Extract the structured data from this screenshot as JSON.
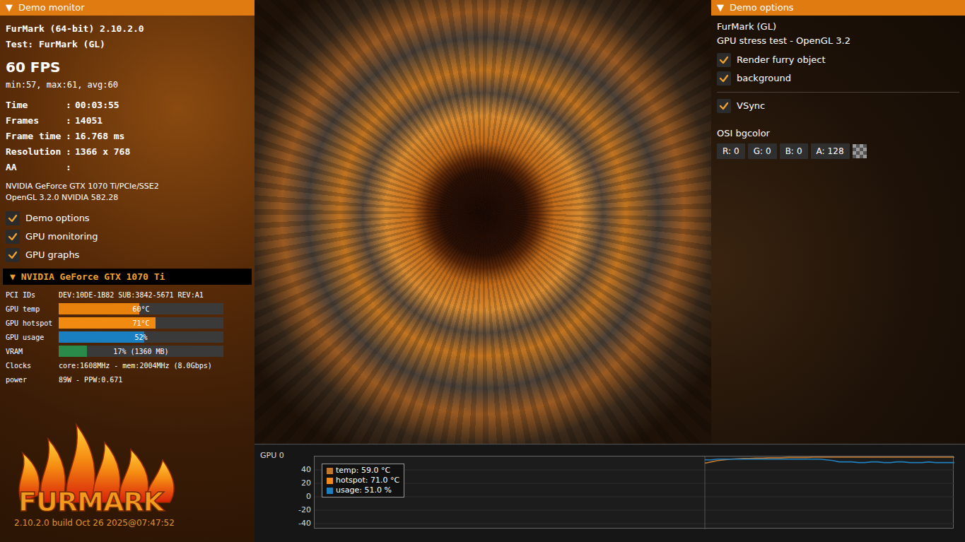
{
  "monitor": {
    "toggle": "▼",
    "title": "Demo monitor",
    "app": "FurMark (64-bit) 2.10.2.0",
    "test": "Test: FurMark (GL)",
    "fps": "60 FPS",
    "fps_stats": "min:57, max:61, avg:60",
    "stats": [
      {
        "label": "Time",
        "sep": ":",
        "value": "00:03:55"
      },
      {
        "label": "Frames",
        "sep": ":",
        "value": "14051"
      },
      {
        "label": "Frame time",
        "sep": ":",
        "value": "16.768 ms"
      },
      {
        "label": "Resolution",
        "sep": ":",
        "value": "1366 x 768"
      },
      {
        "label": "AA",
        "sep": ":",
        "value": ""
      }
    ],
    "renderer": "NVIDIA GeForce GTX 1070 Ti/PCIe/SSE2",
    "gl": "OpenGL 3.2.0 NVIDIA 582.28",
    "toggles": [
      {
        "label": "Demo options",
        "checked": true
      },
      {
        "label": "GPU monitoring",
        "checked": true
      },
      {
        "label": "GPU graphs",
        "checked": true
      }
    ]
  },
  "gpu": {
    "toggle": "▼",
    "title": "NVIDIA GeForce GTX 1070 Ti",
    "rows": [
      {
        "kind": "text",
        "label": "PCI IDs",
        "value": "DEV:10DE-1B82 SUB:3842-5671 REV:A1"
      },
      {
        "kind": "bar",
        "label": "GPU temp",
        "value": "60°C",
        "level": 0.49,
        "color": "#e8820c"
      },
      {
        "kind": "bar",
        "label": "GPU hotspot",
        "value": "71°C",
        "level": 0.59,
        "color": "#f08a10"
      },
      {
        "kind": "bar",
        "label": "GPU usage",
        "value": "52%",
        "level": 0.52,
        "color": "#1a7fc0"
      },
      {
        "kind": "bar",
        "label": "VRAM",
        "value": "17% (1360 MB)",
        "level": 0.17,
        "color": "#2a8a4a"
      },
      {
        "kind": "text",
        "label": "Clocks",
        "value": "core:1608MHz - mem:2004MHz (8.0Gbps)"
      },
      {
        "kind": "text",
        "label": "power",
        "value": "89W - PPW:0.671"
      }
    ]
  },
  "logo": {
    "text": "FURMARK",
    "build": "2.10.2.0 build Oct 26 2025@07:47:52"
  },
  "options": {
    "toggle": "▼",
    "title": "Demo options",
    "name": "FurMark (GL)",
    "subtitle": "GPU stress test - OpenGL 3.2",
    "toggles": [
      {
        "label": "Render furry object",
        "checked": true
      },
      {
        "label": "background",
        "checked": true
      }
    ],
    "vsync": {
      "label": "VSync",
      "checked": true
    },
    "bgcolor": {
      "label": "OSI bgcolor",
      "fields": [
        {
          "label": "R:",
          "value": "0"
        },
        {
          "label": "G:",
          "value": "0"
        },
        {
          "label": "B:",
          "value": "0"
        },
        {
          "label": "A:",
          "value": "128"
        }
      ]
    }
  },
  "chart": {
    "title": "GPU 0",
    "y_ticks": [
      "40",
      "20",
      "0",
      "-20",
      "-40"
    ],
    "legend": [
      {
        "label": "temp: 59.0 °C",
        "color": "#c0772e"
      },
      {
        "label": "hotspot: 71.0 °C",
        "color": "#f08c1e"
      },
      {
        "label": "usage: 51.0 %",
        "color": "#1f80c0"
      }
    ],
    "series": [
      {
        "name": "temp",
        "color": "#c0772e",
        "values": [
          50,
          52,
          54,
          55,
          56,
          56.5,
          57,
          57,
          57.5,
          57.5,
          58,
          58,
          58,
          58.5,
          58.5,
          58.5,
          58.5,
          59,
          59,
          59,
          59,
          59,
          59,
          59,
          59,
          59,
          59,
          59,
          59,
          59,
          59,
          59,
          59,
          59,
          59,
          59,
          59,
          59,
          59,
          59
        ]
      },
      {
        "name": "hotspot",
        "color": "#f08c1e",
        "values": [
          63,
          65,
          66,
          67,
          68,
          68.5,
          69,
          69,
          69.5,
          69.5,
          70,
          70,
          70,
          70.5,
          70.5,
          70.5,
          70.5,
          71,
          71,
          71,
          71,
          71,
          71,
          71,
          71,
          71,
          71,
          71,
          71,
          71,
          71,
          71,
          71,
          71,
          71,
          71,
          71,
          71,
          71,
          71
        ]
      },
      {
        "name": "usage",
        "color": "#1f80c0",
        "values": [
          55,
          55,
          56,
          56,
          56,
          56,
          56,
          56,
          56,
          56,
          56,
          56,
          56,
          56,
          56,
          56,
          56,
          56,
          56,
          55,
          54,
          52,
          52,
          52,
          51,
          51,
          52,
          52,
          51,
          51,
          52,
          52,
          51,
          51,
          51,
          52,
          51,
          51,
          51,
          51
        ]
      }
    ]
  }
}
